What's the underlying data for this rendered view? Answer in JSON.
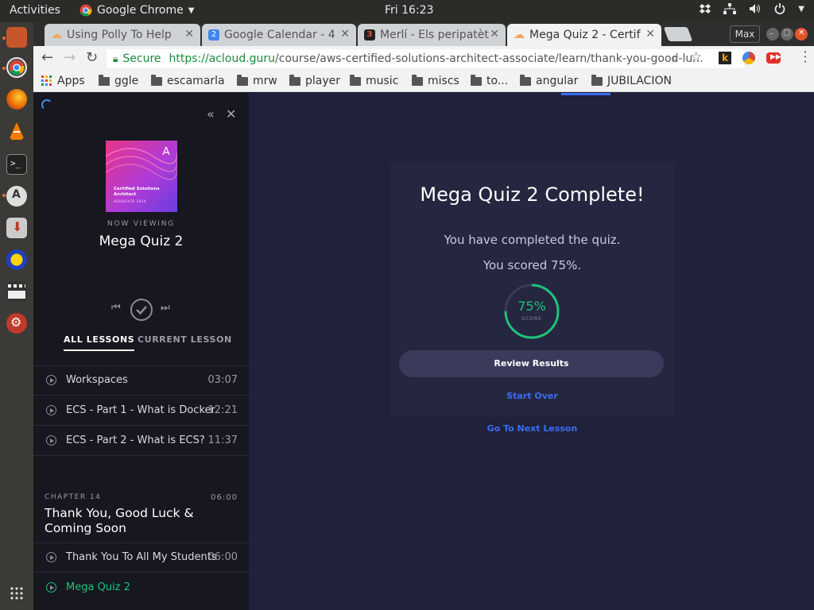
{
  "system": {
    "activities": "Activities",
    "app_name": "Google Chrome",
    "clock": "Fri 16:23"
  },
  "browser": {
    "tabs": [
      {
        "title": "Using Polly To Help",
        "fav_color": "#f4a460"
      },
      {
        "title": "Google Calendar - 4",
        "fav_color": "#4285f4",
        "fav_text": "2"
      },
      {
        "title": "Merlí - Els peripatèt",
        "fav_color": "#c0392b",
        "fav_text": "3"
      },
      {
        "title": "Mega Quiz 2 - Certif",
        "fav_color": "#f4a460"
      }
    ],
    "profile": "Max",
    "secure_label": "Secure",
    "url_host": "https://acloud.guru",
    "url_path": "/course/aws-certified-solutions-architect-associate/learn/thank-you-good-lu...",
    "bookmarks": [
      "Apps",
      "ggle",
      "escamarla",
      "mrw",
      "player",
      "music",
      "miscs",
      "to...",
      "angular",
      "JUBILACION"
    ]
  },
  "sidebar": {
    "now_viewing_label": "NOW VIEWING",
    "current_title": "Mega Quiz 2",
    "course_art_title": "Certified Solutions Architect",
    "course_art_sub": "ASSOCIATE 2019",
    "tabs": [
      "ALL LESSONS",
      "CURRENT LESSON"
    ],
    "lessons": [
      {
        "title": "Workspaces",
        "duration": "03:07"
      },
      {
        "title": "ECS - Part 1 - What is Docker",
        "duration": "12:21"
      },
      {
        "title": "ECS - Part 2 - What is ECS?",
        "duration": "11:37"
      }
    ],
    "chapter": {
      "label": "CHAPTER 14",
      "duration": "06:00",
      "title_line1": "Thank You, Good Luck &",
      "title_line2": "Coming Soon"
    },
    "chapter_lessons": [
      {
        "title": "Thank You To All My Students",
        "duration": "06:00"
      },
      {
        "title": "Mega Quiz 2",
        "duration": ""
      }
    ]
  },
  "quiz": {
    "heading": "Mega Quiz 2 Complete!",
    "completed_text": "You have completed the quiz.",
    "score_text": "You scored 75%.",
    "score_value": "75%",
    "score_fraction": 0.75,
    "score_label": "SCORE",
    "review_button": "Review Results",
    "start_over": "Start Over",
    "next_lesson": "Go To Next Lesson",
    "accent": "#1ec27a",
    "link_color": "#3b6cf6"
  }
}
